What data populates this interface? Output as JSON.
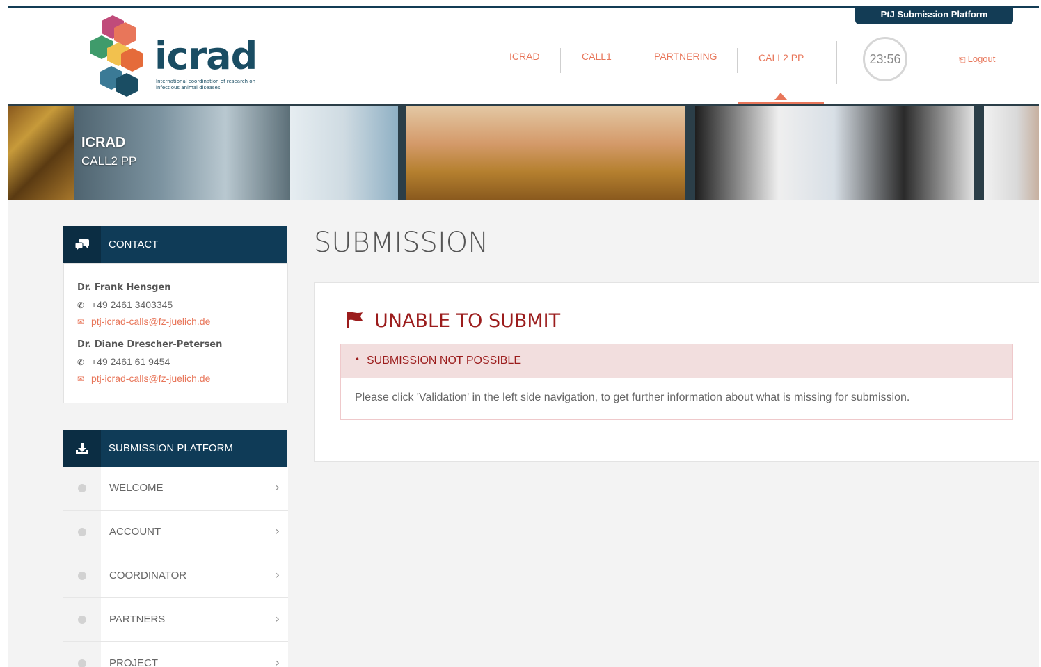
{
  "header": {
    "platform_tab": "PtJ Submission Platform",
    "logo": {
      "word": "icrad",
      "subtitle": "International coordination of research on infectious animal diseases"
    },
    "nav": [
      {
        "label": "ICRAD"
      },
      {
        "label": "CALL1"
      },
      {
        "label": "PARTNERING"
      },
      {
        "label": "CALL2 PP",
        "active": true
      }
    ],
    "timer": "23:56",
    "logout": "Logout",
    "accent_color": "#e8765a",
    "brand_color": "#133c55"
  },
  "banner": {
    "title": "ICRAD",
    "subtitle": "CALL2 PP"
  },
  "contact": {
    "heading": "CONTACT",
    "people": [
      {
        "name": "Dr. Frank Hensgen",
        "phone": "+49 2461 3403345",
        "email": "ptj-icrad-calls@fz-juelich.de"
      },
      {
        "name": "Dr. Diane Drescher-Petersen",
        "phone": "+49 2461 61 9454",
        "email": "ptj-icrad-calls@fz-juelich.de"
      }
    ]
  },
  "submission_platform": {
    "heading": "SUBMISSION PLATFORM",
    "items": [
      {
        "label": "WELCOME"
      },
      {
        "label": "ACCOUNT"
      },
      {
        "label": "COORDINATOR"
      },
      {
        "label": "PARTNERS"
      },
      {
        "label": "PROJECT"
      }
    ]
  },
  "main": {
    "title": "SUBMISSION",
    "error_heading": "UNABLE TO SUBMIT",
    "alert_title": "SUBMISSION NOT POSSIBLE",
    "alert_message": "Please click 'Validation' in the left side navigation, to get further information about what is missing for submission."
  }
}
